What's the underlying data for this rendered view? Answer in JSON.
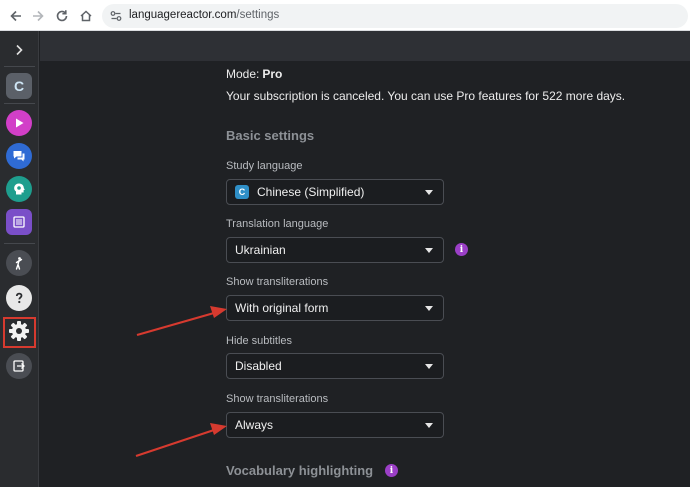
{
  "browser": {
    "url_host": "languagereactor.com",
    "url_path": "/settings"
  },
  "sidebar": {
    "language_badge": "C"
  },
  "account": {
    "mode_label": "Mode:",
    "mode_value": "Pro",
    "subscription_note": "Your subscription is canceled. You can use Pro features for 522 more days."
  },
  "basic_settings": {
    "heading": "Basic settings",
    "study_language": {
      "label": "Study language",
      "flag": "C",
      "value": "Chinese (Simplified)"
    },
    "translation_language": {
      "label": "Translation language",
      "value": "Ukrainian"
    },
    "show_transliterations": {
      "label": "Show transliterations",
      "value": "With original form"
    },
    "hide_subtitles": {
      "label": "Hide subtitles",
      "value": "Disabled"
    },
    "show_transliterations_2": {
      "label": "Show transliterations",
      "value": "Always"
    }
  },
  "vocabulary": {
    "heading": "Vocabulary highlighting"
  },
  "info_glyph": "i",
  "colors": {
    "accent_purple": "#9b3fc7",
    "annotation_red": "#d63a2f",
    "play_pink": "#d23fc8",
    "chat_blue": "#2f6bd4",
    "brain_teal": "#1e9e8e",
    "list_purple": "#7a4fc8"
  }
}
